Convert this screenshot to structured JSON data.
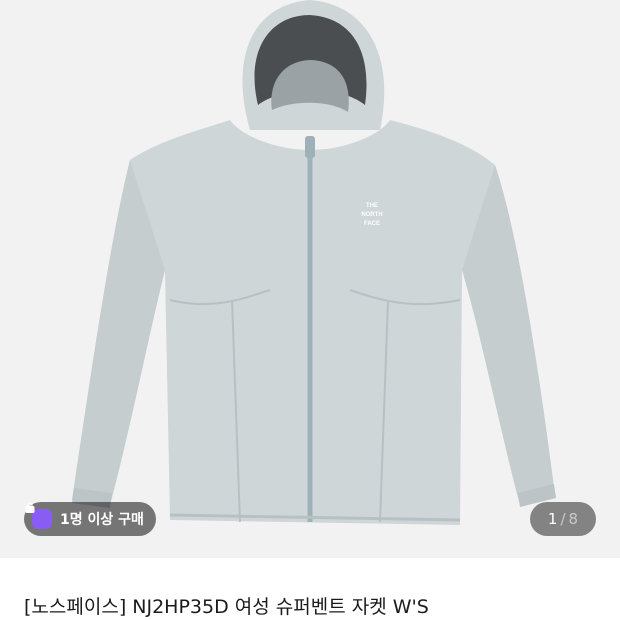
{
  "product": {
    "title": "[노스페이스] NJ2HP35D 여성 슈퍼벤트 자켓 W'S",
    "brand_logo_text": "THE NORTH FACE",
    "main_color": "#cfd6d8",
    "background_color": "#f2f2f2"
  },
  "badge": {
    "icon": "shopping-bag-icon",
    "label": "1명 이상 구매",
    "icon_color": "#8a5cf6"
  },
  "pagination": {
    "current": "1",
    "separator": "/",
    "total": "8"
  }
}
